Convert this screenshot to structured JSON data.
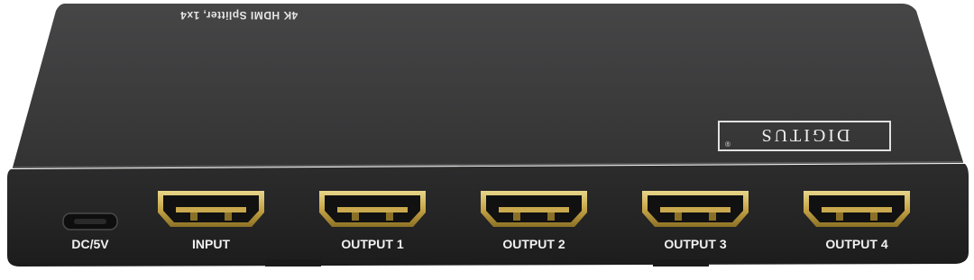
{
  "device": {
    "top_label": "4K HDMI Splitter, 1x4",
    "brand": "DIGITUS",
    "brand_mark": "®",
    "body_color": "#3a3a3b",
    "port_gold": "#c9a94a",
    "ports": [
      {
        "label": "DC/5V",
        "kind": "micro-usb"
      },
      {
        "label": "INPUT",
        "kind": "hdmi"
      },
      {
        "label": "OUTPUT 1",
        "kind": "hdmi"
      },
      {
        "label": "OUTPUT 2",
        "kind": "hdmi"
      },
      {
        "label": "OUTPUT 3",
        "kind": "hdmi"
      },
      {
        "label": "OUTPUT 4",
        "kind": "hdmi"
      }
    ]
  }
}
